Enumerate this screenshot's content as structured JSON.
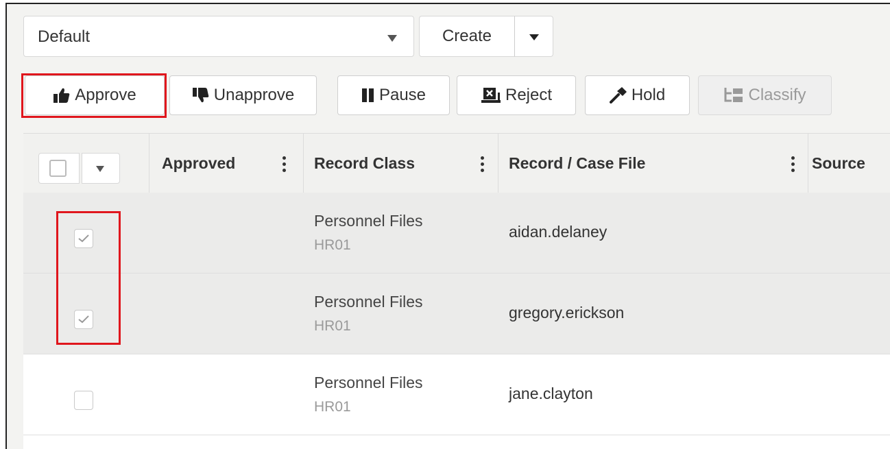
{
  "view_select": {
    "value": "Default"
  },
  "create": {
    "label": "Create"
  },
  "toolbar": {
    "approve": "Approve",
    "unapprove": "Unapprove",
    "pause": "Pause",
    "reject": "Reject",
    "hold": "Hold",
    "classify": "Classify"
  },
  "table": {
    "columns": [
      "Approved",
      "Record Class",
      "Record / Case File",
      "Source"
    ],
    "rows": [
      {
        "record_class": "Personnel Files",
        "code": "HR01",
        "record": "aidan.delaney",
        "checked": true
      },
      {
        "record_class": "Personnel Files",
        "code": "HR01",
        "record": "gregory.erickson",
        "checked": true
      },
      {
        "record_class": "Personnel Files",
        "code": "HR01",
        "record": "jane.clayton",
        "checked": false
      }
    ]
  },
  "colors": {
    "highlight": "#e0161d",
    "selected_row": "#ebebea"
  }
}
